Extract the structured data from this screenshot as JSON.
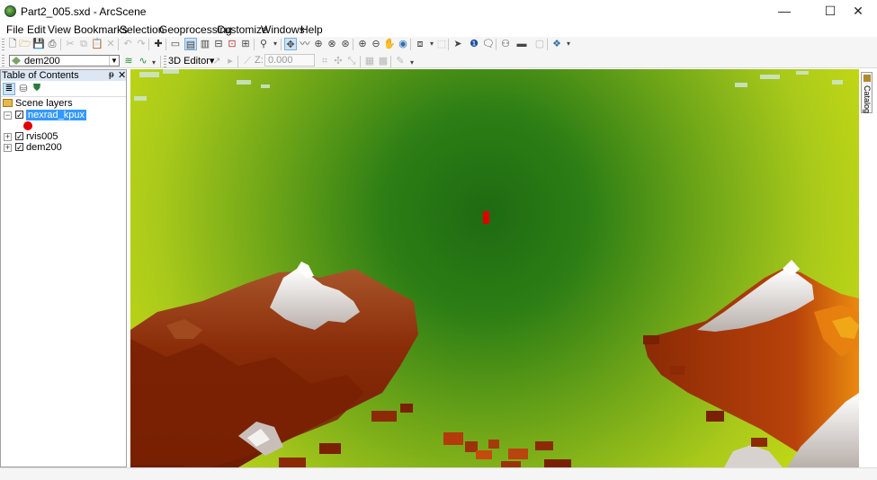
{
  "window": {
    "title": "Part2_005.sxd - ArcScene",
    "minimize_glyph": "—",
    "maximize_glyph": "☐",
    "close_glyph": "✕"
  },
  "menu": [
    "File",
    "Edit",
    "View",
    "Bookmarks",
    "Selection",
    "Geoprocessing",
    "Customize",
    "Windows",
    "Help"
  ],
  "toolbar2": {
    "layer_dropdown_value": "dem200",
    "editor_3d_label": "3D Editor",
    "z_label": "Z:",
    "z_value": "0.000"
  },
  "toc": {
    "title": "Table of Contents",
    "pin_glyph": "ᵽ",
    "close_glyph": "✕",
    "scene_layers_label": "Scene layers",
    "layers": [
      {
        "name": "nexrad_kpux",
        "checked": true,
        "expanded": true,
        "selected": true
      },
      {
        "name": "rvis005",
        "checked": true,
        "expanded": false,
        "selected": false
      },
      {
        "name": "dem200",
        "checked": true,
        "expanded": false,
        "selected": false
      }
    ]
  },
  "catalog_tab": {
    "label": "Catalog"
  },
  "colors": {
    "selected_layer": "#3399ff",
    "symbol_red": "#e00000",
    "terrain_low": "#1e6b12",
    "terrain_mid": "#a8c81e",
    "terrain_high": "#8b2a05",
    "snow": "#f2f2f2"
  }
}
